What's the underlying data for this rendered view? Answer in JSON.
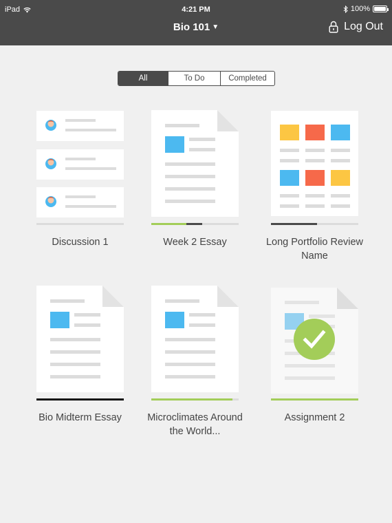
{
  "status_bar": {
    "device": "iPad",
    "time": "4:21 PM",
    "battery": "100%"
  },
  "header": {
    "course_title": "Bio 101",
    "logout_label": "Log Out"
  },
  "filter": {
    "tabs": [
      "All",
      "To Do",
      "Completed"
    ],
    "selected": "All"
  },
  "colors": {
    "header_bg": "#4a4a4a",
    "green": "#a3cd59",
    "blue": "#4cb9f0",
    "orange": "#f6694a",
    "yellow": "#fcc643",
    "dark": "#4a4a4a"
  },
  "items": [
    {
      "label": "Discussion 1",
      "thumbnail": "discussion-thumbnail",
      "progress": 0
    },
    {
      "label": "Week 2 Essay",
      "thumbnail": "document-thumbnail",
      "progress": 0.58
    },
    {
      "label": "Long Portfolio Review Name",
      "thumbnail": "portfolio-thumbnail",
      "progress": 0.53
    },
    {
      "label": "Bio Midterm Essay",
      "thumbnail": "document-thumbnail",
      "progress": 1.0
    },
    {
      "label": "Microclimates Around the World...",
      "thumbnail": "document-thumbnail",
      "progress": 0.93
    },
    {
      "label": "Assignment 2",
      "thumbnail": "completed-document-thumbnail",
      "progress": 1.0
    }
  ]
}
